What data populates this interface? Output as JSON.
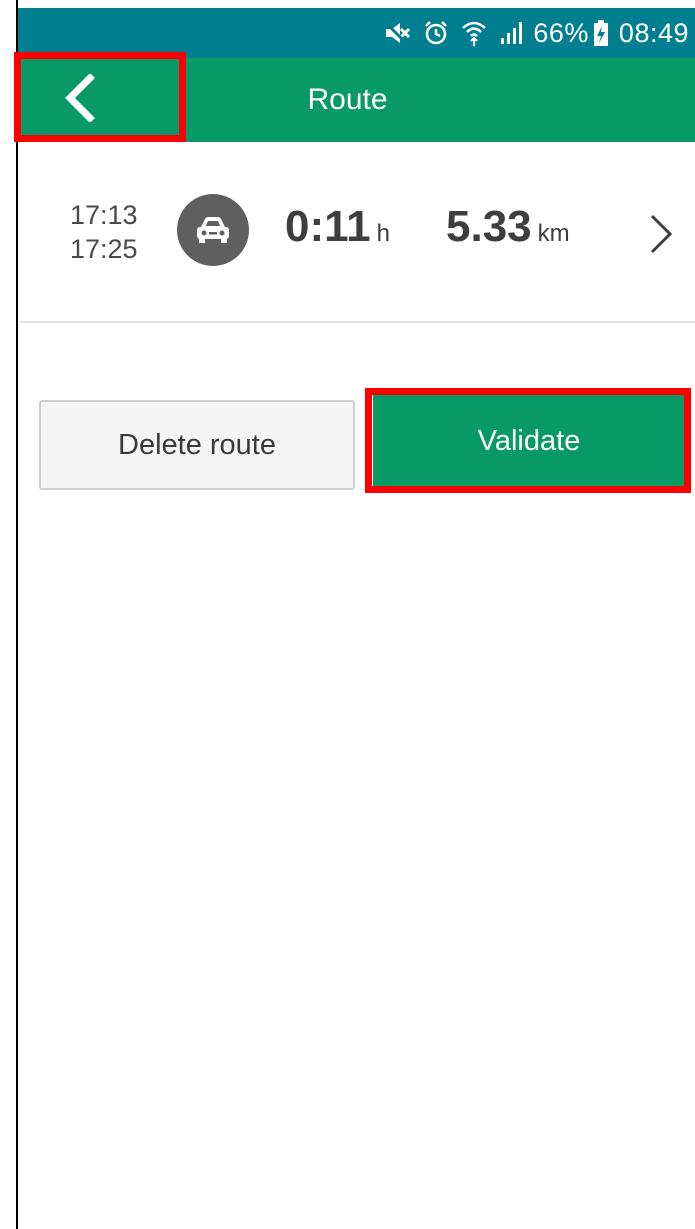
{
  "status_bar": {
    "icons": [
      "mute-icon",
      "alarm-icon",
      "wifi-icon",
      "signal-icon",
      "battery-charging-icon"
    ],
    "battery": "66%",
    "time": "08:49",
    "color": "#027e91"
  },
  "app_bar": {
    "title": "Route",
    "back_icon": "chevron-left-icon",
    "color": "#079966"
  },
  "route": {
    "start_time": "17:13",
    "end_time": "17:25",
    "mode_icon": "car-icon",
    "duration_value": "0:11",
    "duration_unit": "h",
    "distance_value": "5.33",
    "distance_unit": "km",
    "detail_icon": "chevron-right-icon"
  },
  "actions": {
    "delete_label": "Delete route",
    "validate_label": "Validate"
  },
  "highlights": {
    "color": "#ff0000",
    "targets": [
      "back-button",
      "validate-button"
    ]
  }
}
